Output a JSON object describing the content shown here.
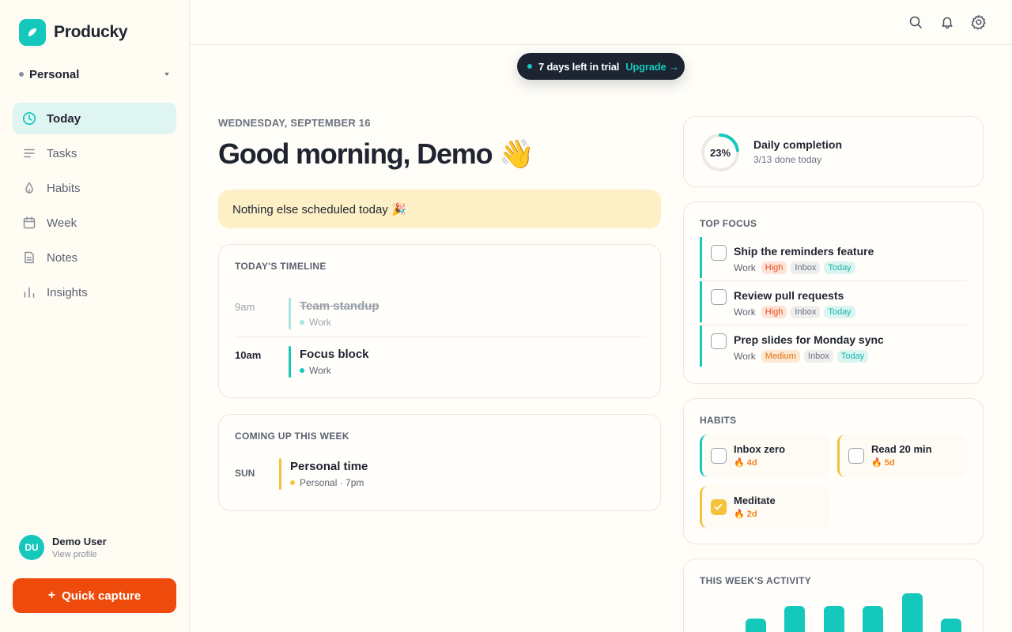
{
  "brand": {
    "name": "Producky",
    "accent": "#14c8bc"
  },
  "workspace": {
    "name": "Personal"
  },
  "nav": [
    {
      "label": "Today",
      "icon": "clock-icon",
      "active": true
    },
    {
      "label": "Tasks",
      "icon": "list-icon"
    },
    {
      "label": "Habits",
      "icon": "drop-icon"
    },
    {
      "label": "Week",
      "icon": "calendar-icon"
    },
    {
      "label": "Notes",
      "icon": "note-icon"
    },
    {
      "label": "Insights",
      "icon": "bar-chart-icon"
    }
  ],
  "user": {
    "initials": "DU",
    "name": "Demo User",
    "link": "View profile"
  },
  "capture": {
    "label": "Quick capture",
    "color": "#ee4a0c"
  },
  "topbar": {
    "icons": [
      "search-icon",
      "bell-icon",
      "gear-icon"
    ]
  },
  "trial": {
    "text": "7 days left in trial",
    "link": "Upgrade →"
  },
  "header": {
    "date": "WEDNESDAY, SEPTEMBER 16",
    "greeting": "Good morning, Demo 👋"
  },
  "banner": {
    "text": "Nothing else scheduled today 🎉",
    "color": "#fdf0c6"
  },
  "timeline": {
    "title": "TODAY'S TIMELINE",
    "items": [
      {
        "time": "9am",
        "title": "Team standup",
        "project": "Work",
        "done": true
      },
      {
        "time": "10am",
        "title": "Focus block",
        "project": "Work",
        "done": false
      }
    ]
  },
  "upcoming": {
    "title": "COMING UP THIS WEEK",
    "items": [
      {
        "day": "SUN",
        "title": "Personal time",
        "meta": "Personal · 7pm",
        "color": "#f4c23b"
      }
    ]
  },
  "completion": {
    "percent": "23%",
    "fraction": 0.23,
    "title": "Daily completion",
    "sub": "3/13 done today"
  },
  "focus": {
    "title": "TOP FOCUS",
    "items": [
      {
        "title": "Ship the reminders feature",
        "project": "Work",
        "priority": "High",
        "list": "Inbox",
        "when": "Today"
      },
      {
        "title": "Review pull requests",
        "project": "Work",
        "priority": "High",
        "list": "Inbox",
        "when": "Today"
      },
      {
        "title": "Prep slides for Monday sync",
        "project": "Work",
        "priority": "Medium",
        "list": "Inbox",
        "when": "Today"
      }
    ]
  },
  "habits": {
    "title": "HABITS",
    "items": [
      {
        "name": "Inbox zero",
        "streak": "4d",
        "checked": false,
        "color": "#14c8bc"
      },
      {
        "name": "Read 20 min",
        "streak": "5d",
        "checked": false,
        "color": "#f4c23b"
      },
      {
        "name": "Meditate",
        "streak": "2d",
        "checked": true,
        "color": "#f4c23b"
      }
    ]
  },
  "activity": {
    "title": "THIS WEEK'S ACTIVITY",
    "values": [
      0,
      2,
      4,
      4,
      4,
      6,
      2
    ]
  }
}
